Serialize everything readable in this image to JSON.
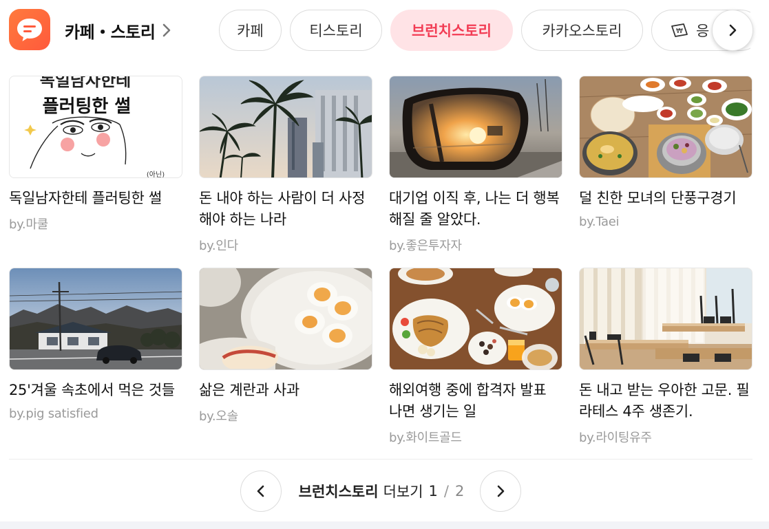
{
  "header": {
    "title": "카페・스토리",
    "tabs": [
      {
        "label": "카페",
        "active": false
      },
      {
        "label": "티스토리",
        "active": false
      },
      {
        "label": "브런치스토리",
        "active": true
      },
      {
        "label": "카카오스토리",
        "active": false
      },
      {
        "label": "응",
        "active": false,
        "icon": "money-icon"
      }
    ]
  },
  "cards": [
    {
      "title": "독일남자한테 플러팅한 썰",
      "author": "by.마쿨",
      "thumb_text": "플러팅한 썰",
      "thumb_text_top": "독일남자한테",
      "thumb_note": "(아닌)"
    },
    {
      "title": "돈 내야 하는 사람이 더 사정해야 하는 나라",
      "author": "by.인다"
    },
    {
      "title": "대기업 이직 후, 나는 더 행복해질 줄 알았다.",
      "author": "by.좋은투자자"
    },
    {
      "title": "덜 친한 모녀의 단풍구경기",
      "author": "by.Taei"
    },
    {
      "title": "25'겨울 속초에서 먹은 것들",
      "author": "by.pig satisfied"
    },
    {
      "title": "삶은 계란과 사과",
      "author": "by.오솔"
    },
    {
      "title": "해외여행 중에 합격자 발표 나면 생기는 일",
      "author": "by.화이트골드"
    },
    {
      "title": "돈 내고 받는 우아한 고문. 필라테스 4주 생존기.",
      "author": "by.라이팅유주"
    }
  ],
  "pager": {
    "section": "브런치스토리",
    "more": "더보기",
    "current": "1",
    "separator": "/",
    "total": "2"
  },
  "colors": {
    "accent": "#f23c54",
    "active_tab_bg": "#ffe3e6",
    "logo": "#ff5a3c",
    "author": "#9a9a9a"
  }
}
